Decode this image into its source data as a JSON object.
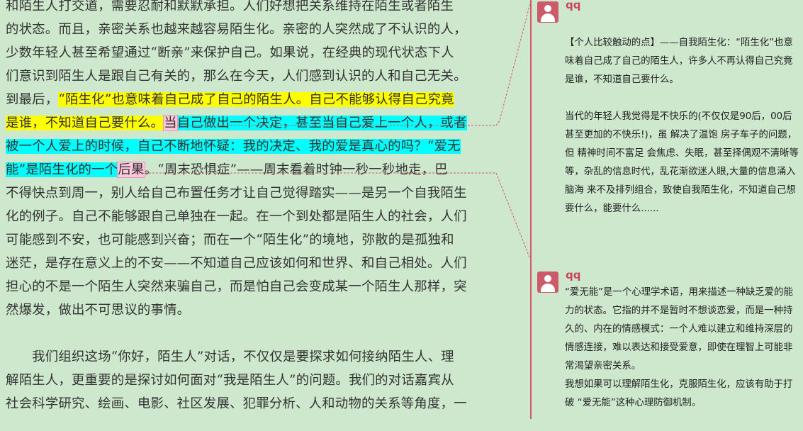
{
  "document": {
    "lines": [
      {
        "segments": [
          {
            "text": "和陌生人打交道，需要忍耐和默默承担。人们好想把关系维持在陌生或者陌生",
            "hl": ""
          }
        ]
      },
      {
        "segments": [
          {
            "text": "的状态。而且，亲密关系也越来越容易陌生化。亲密的人突然成了不认识的人，",
            "hl": ""
          }
        ]
      },
      {
        "segments": [
          {
            "text": "少数年轻人甚至希望通过“断亲”来保护自己。如果说，在经典的现代状态下人",
            "hl": ""
          }
        ]
      },
      {
        "segments": [
          {
            "text": "们意识到陌生人是跟自己有关的，那么在今天，人们感到认识的人和自己无关。",
            "hl": ""
          }
        ]
      },
      {
        "segments": [
          {
            "text": "到最后，",
            "hl": ""
          },
          {
            "text": "“陌生化”也意味着自己成了自己的陌生人。自己不能够认得自己究竟",
            "hl": "y"
          }
        ]
      },
      {
        "segments": [
          {
            "text": "是谁，不知道自己要什么。",
            "hl": "y"
          },
          {
            "text": "当",
            "hl": "p"
          },
          {
            "text": "自己做出一个决定，甚至当自己爱上一个人，或者",
            "hl": "c"
          }
        ]
      },
      {
        "segments": [
          {
            "text": "被一个人爱上的时候，自己不断地怀疑：我的决定、我的爱是真心的吗？“爱无",
            "hl": "c"
          }
        ]
      },
      {
        "segments": [
          {
            "text": "能”是陌生化的一个",
            "hl": "c"
          },
          {
            "text": "后果",
            "hl": "p"
          },
          {
            "text": "。“周末恐惧症”——周末看着时钟一秒一秒地走，巴",
            "hl": ""
          }
        ]
      },
      {
        "segments": [
          {
            "text": "不得快点到周一，别人给自己布置任务才让自己觉得踏实——是另一个自我陌生",
            "hl": ""
          }
        ]
      },
      {
        "segments": [
          {
            "text": "化的例子。自己不能够跟自己单独在一起。在一个到处都是陌生人的社会，人们",
            "hl": ""
          }
        ]
      },
      {
        "segments": [
          {
            "text": "可能感到不安，也可能感到兴奋；而在一个“陌生化”的境地，弥散的是孤独和",
            "hl": ""
          }
        ]
      },
      {
        "segments": [
          {
            "text": "迷茫，是存在意义上的不安——不知道自己应该如何和世界、和自己相处。人们",
            "hl": ""
          }
        ]
      },
      {
        "segments": [
          {
            "text": "担心的不是一个陌生人突然来骗自己，而是怕自己会变成某一个陌生人那样，突",
            "hl": ""
          }
        ]
      },
      {
        "segments": [
          {
            "text": "然爆发，做出不可思议的事情。",
            "hl": ""
          }
        ]
      },
      {
        "segments": [
          {
            "text": "",
            "hl": ""
          }
        ]
      },
      {
        "segments": [
          {
            "text": "　　我们组织这场“你好，陌生人”对话，不仅仅是要探求如何接纳陌生人、理",
            "hl": ""
          }
        ]
      },
      {
        "segments": [
          {
            "text": "解陌生人，更重要的是探讨如何面对“我是陌生人”的问题。我们的对话嘉宾从",
            "hl": ""
          }
        ]
      },
      {
        "segments": [
          {
            "text": "社会科学研究、绘画、电影、社区发展、犯罪分析、人和动物的关系等角度，一",
            "hl": ""
          }
        ]
      }
    ]
  },
  "comments": [
    {
      "author": "qq",
      "avatar_icon": "user-avatar-icon",
      "text": "【个人比较触动的点】——自我陌生化：“陌生化”也意味着自己成了自己的陌生人，许多人不再认得自己究竟是谁，不知道自己要什么。\n\n当代的年轻人我觉得是不快乐的(不仅仅是90后，00后甚至更加的不快乐!)，虽 解决了温饱 房子车子的问题，但 精神时间不富足 会焦虑、失眠，甚至择偶观不清晰等等，杂乱的信息时代，乱花渐欲迷人眼,大量的信息涌入脑海 来不及排列组合，致使自我陌生化，不知道自己想要什么，能要什么......"
    },
    {
      "author": "qq",
      "avatar_icon": "user-avatar-icon",
      "text": "“爱无能”是一个心理学术语，用来描述一种缺乏爱的能力的状态。它指的并不是暂时不想谈恋爱，而是一种持久的、内在的情感模式：一个人难以建立和维持深层的情感连接，难以表达和接受爱意，即使在理智上可能非常渴望亲密关系。\n我想如果可以理解陌生化，克服陌生化，应该有助于打破 “爱无能”这种心理防御机制。"
    }
  ],
  "colors": {
    "background": "#cde8cd",
    "highlight_yellow": "#ffff00",
    "highlight_cyan": "#00ffff",
    "highlight_pink": "#ffc8dc",
    "comment_accent": "#c9455a"
  }
}
